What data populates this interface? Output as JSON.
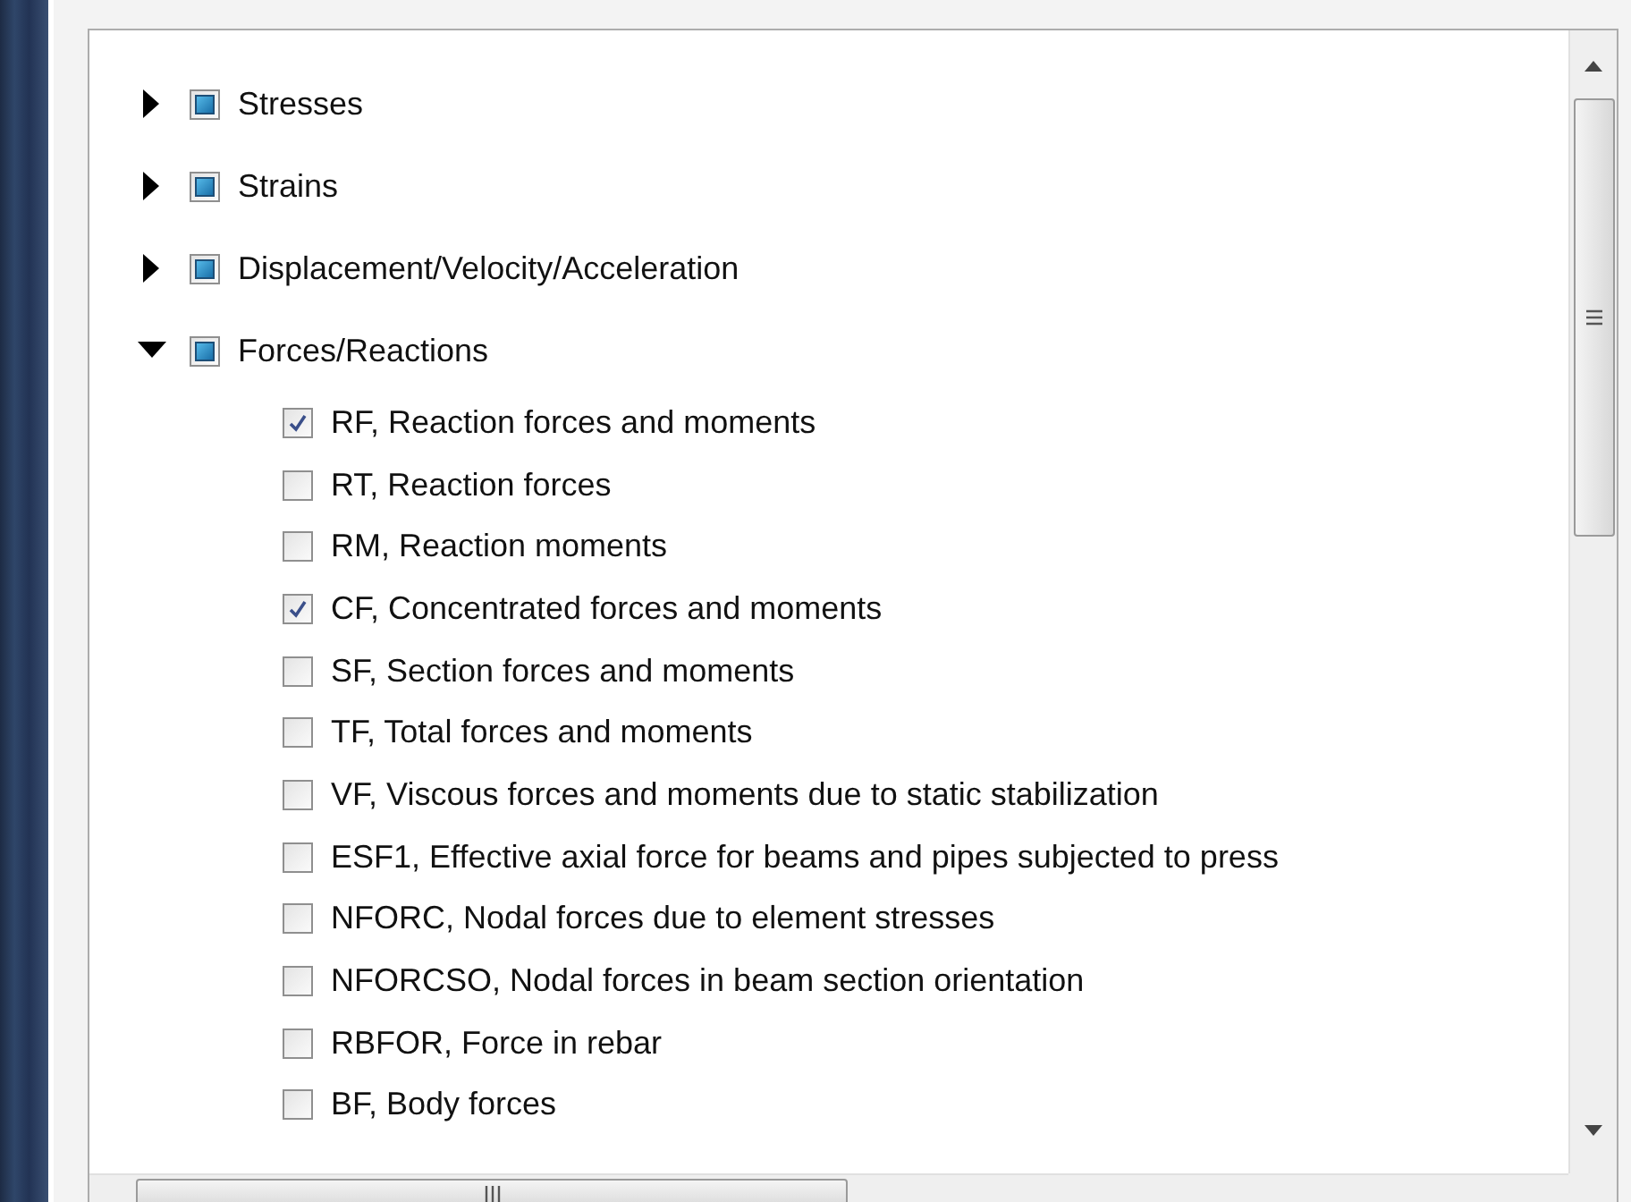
{
  "tree": [
    {
      "label": "Stresses",
      "expanded": false,
      "partial": true
    },
    {
      "label": "Strains",
      "expanded": false,
      "partial": true
    },
    {
      "label": "Displacement/Velocity/Acceleration",
      "expanded": false,
      "partial": true
    },
    {
      "label": "Forces/Reactions",
      "expanded": true,
      "partial": true,
      "children": [
        {
          "label": "RF, Reaction forces and moments",
          "checked": true
        },
        {
          "label": "RT, Reaction forces",
          "checked": false
        },
        {
          "label": "RM, Reaction moments",
          "checked": false
        },
        {
          "label": "CF, Concentrated forces and moments",
          "checked": true
        },
        {
          "label": "SF, Section forces and moments",
          "checked": false
        },
        {
          "label": "TF, Total forces and moments",
          "checked": false
        },
        {
          "label": "VF, Viscous forces and moments due to static stabilization",
          "checked": false
        },
        {
          "label": "ESF1, Effective axial force for beams and pipes subjected to press",
          "checked": false
        },
        {
          "label": "NFORC, Nodal forces due to element stresses",
          "checked": false
        },
        {
          "label": "NFORCSO, Nodal forces in beam section orientation",
          "checked": false
        },
        {
          "label": "RBFOR, Force in rebar",
          "checked": false
        },
        {
          "label": "BF, Body forces",
          "checked": false
        }
      ]
    }
  ]
}
